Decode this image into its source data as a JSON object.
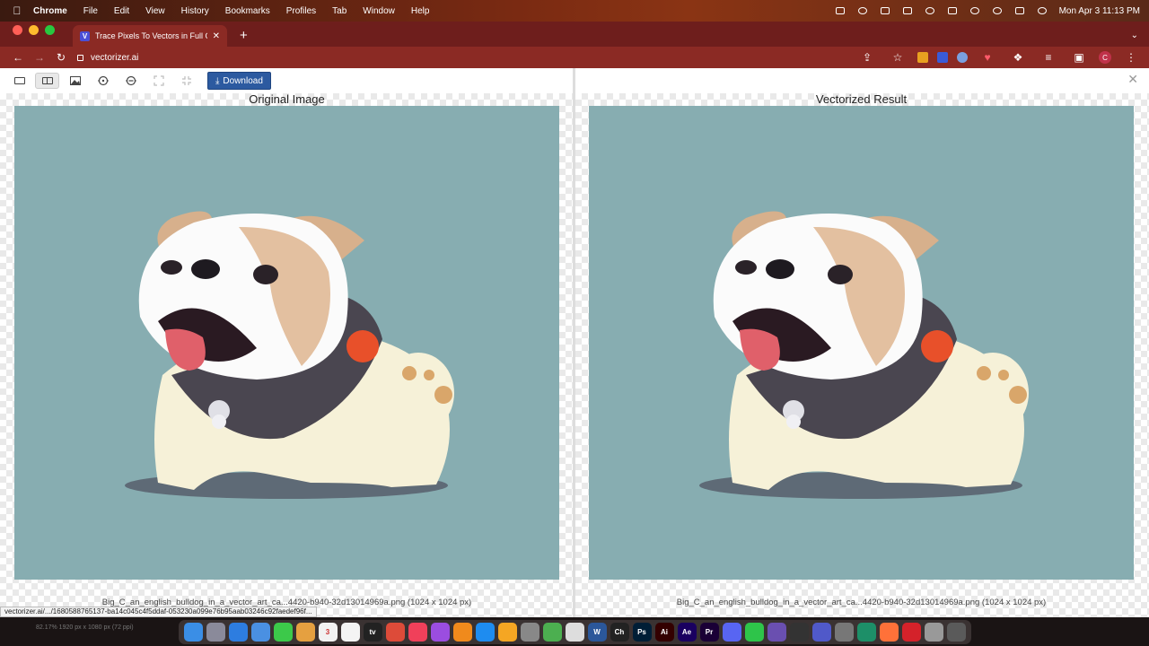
{
  "menubar": {
    "app": "Chrome",
    "items": [
      "File",
      "Edit",
      "View",
      "History",
      "Bookmarks",
      "Profiles",
      "Tab",
      "Window",
      "Help"
    ],
    "clock": "Mon Apr 3  11:13 PM"
  },
  "browser": {
    "tab_title": "Trace Pixels To Vectors in Full C",
    "favicon": "V",
    "url": "vectorizer.ai",
    "profile_initial": "C"
  },
  "toolbar": {
    "download_label": "Download"
  },
  "panes": {
    "left_title": "Original Image",
    "right_title": "Vectorized Result",
    "left_caption": "Big_C_an_english_bulldog_in_a_vector_art_ca...4420-b940-32d13014969a.png (1024 x 1024 px)",
    "right_caption": "Big_C_an_english_bulldog_in_a_vector_art_ca...4420-b940-32d13014969a.png (1024 x 1024 px)",
    "background_color": "#87adb1"
  },
  "status_link": "vectorizer.ai/.../1680588765137-ba14c045c4f5ddaf-053230a099e76b95aab03246c92faedef96f...",
  "dock": {
    "left_text": "82.17%      1920 px x 1080 px (72 ppi)",
    "icons": [
      {
        "name": "finder",
        "color": "#3a8ee6",
        "label": ""
      },
      {
        "name": "launchpad",
        "color": "#8a8a9a",
        "label": ""
      },
      {
        "name": "safari",
        "color": "#2d7de0",
        "label": ""
      },
      {
        "name": "mail",
        "color": "#4a90e2",
        "label": ""
      },
      {
        "name": "messages",
        "color": "#3cc94a",
        "label": ""
      },
      {
        "name": "photos",
        "color": "#e5a040",
        "label": ""
      },
      {
        "name": "calendar",
        "color": "#f2f2f2",
        "label": "3"
      },
      {
        "name": "notes",
        "color": "#f4f4f4",
        "label": ""
      },
      {
        "name": "tv",
        "color": "#222222",
        "label": "tv"
      },
      {
        "name": "chrome",
        "color": "#dd4b39",
        "label": ""
      },
      {
        "name": "music",
        "color": "#f0405a",
        "label": ""
      },
      {
        "name": "podcasts",
        "color": "#9b4de0",
        "label": ""
      },
      {
        "name": "vlc",
        "color": "#f08a1c",
        "label": ""
      },
      {
        "name": "app-store",
        "color": "#1e8cf0",
        "label": ""
      },
      {
        "name": "books",
        "color": "#f5a623",
        "label": ""
      },
      {
        "name": "settings",
        "color": "#888888",
        "label": ""
      },
      {
        "name": "maps",
        "color": "#4caf50",
        "label": ""
      },
      {
        "name": "tool",
        "color": "#dddddd",
        "label": ""
      },
      {
        "name": "word",
        "color": "#2b579a",
        "label": "W"
      },
      {
        "name": "chatgpt",
        "color": "#222222",
        "label": "Ch"
      },
      {
        "name": "photoshop",
        "color": "#001e36",
        "label": "Ps"
      },
      {
        "name": "illustrator",
        "color": "#330000",
        "label": "Ai"
      },
      {
        "name": "after-effects",
        "color": "#1a0060",
        "label": "Ae"
      },
      {
        "name": "premiere",
        "color": "#1a0036",
        "label": "Pr"
      },
      {
        "name": "discord",
        "color": "#5865f2",
        "label": ""
      },
      {
        "name": "facetime",
        "color": "#2ec44a",
        "label": ""
      },
      {
        "name": "app",
        "color": "#6a4fb0",
        "label": ""
      },
      {
        "name": "play",
        "color": "#333333",
        "label": ""
      },
      {
        "name": "teams",
        "color": "#5059c9",
        "label": ""
      },
      {
        "name": "preview",
        "color": "#777777",
        "label": ""
      },
      {
        "name": "edge",
        "color": "#1d8f68",
        "label": ""
      },
      {
        "name": "firefox",
        "color": "#ff7139",
        "label": ""
      },
      {
        "name": "acrobat",
        "color": "#d4222a",
        "label": ""
      },
      {
        "name": "disk",
        "color": "#999999",
        "label": ""
      },
      {
        "name": "trash",
        "color": "#5a5a5a",
        "label": ""
      }
    ]
  }
}
